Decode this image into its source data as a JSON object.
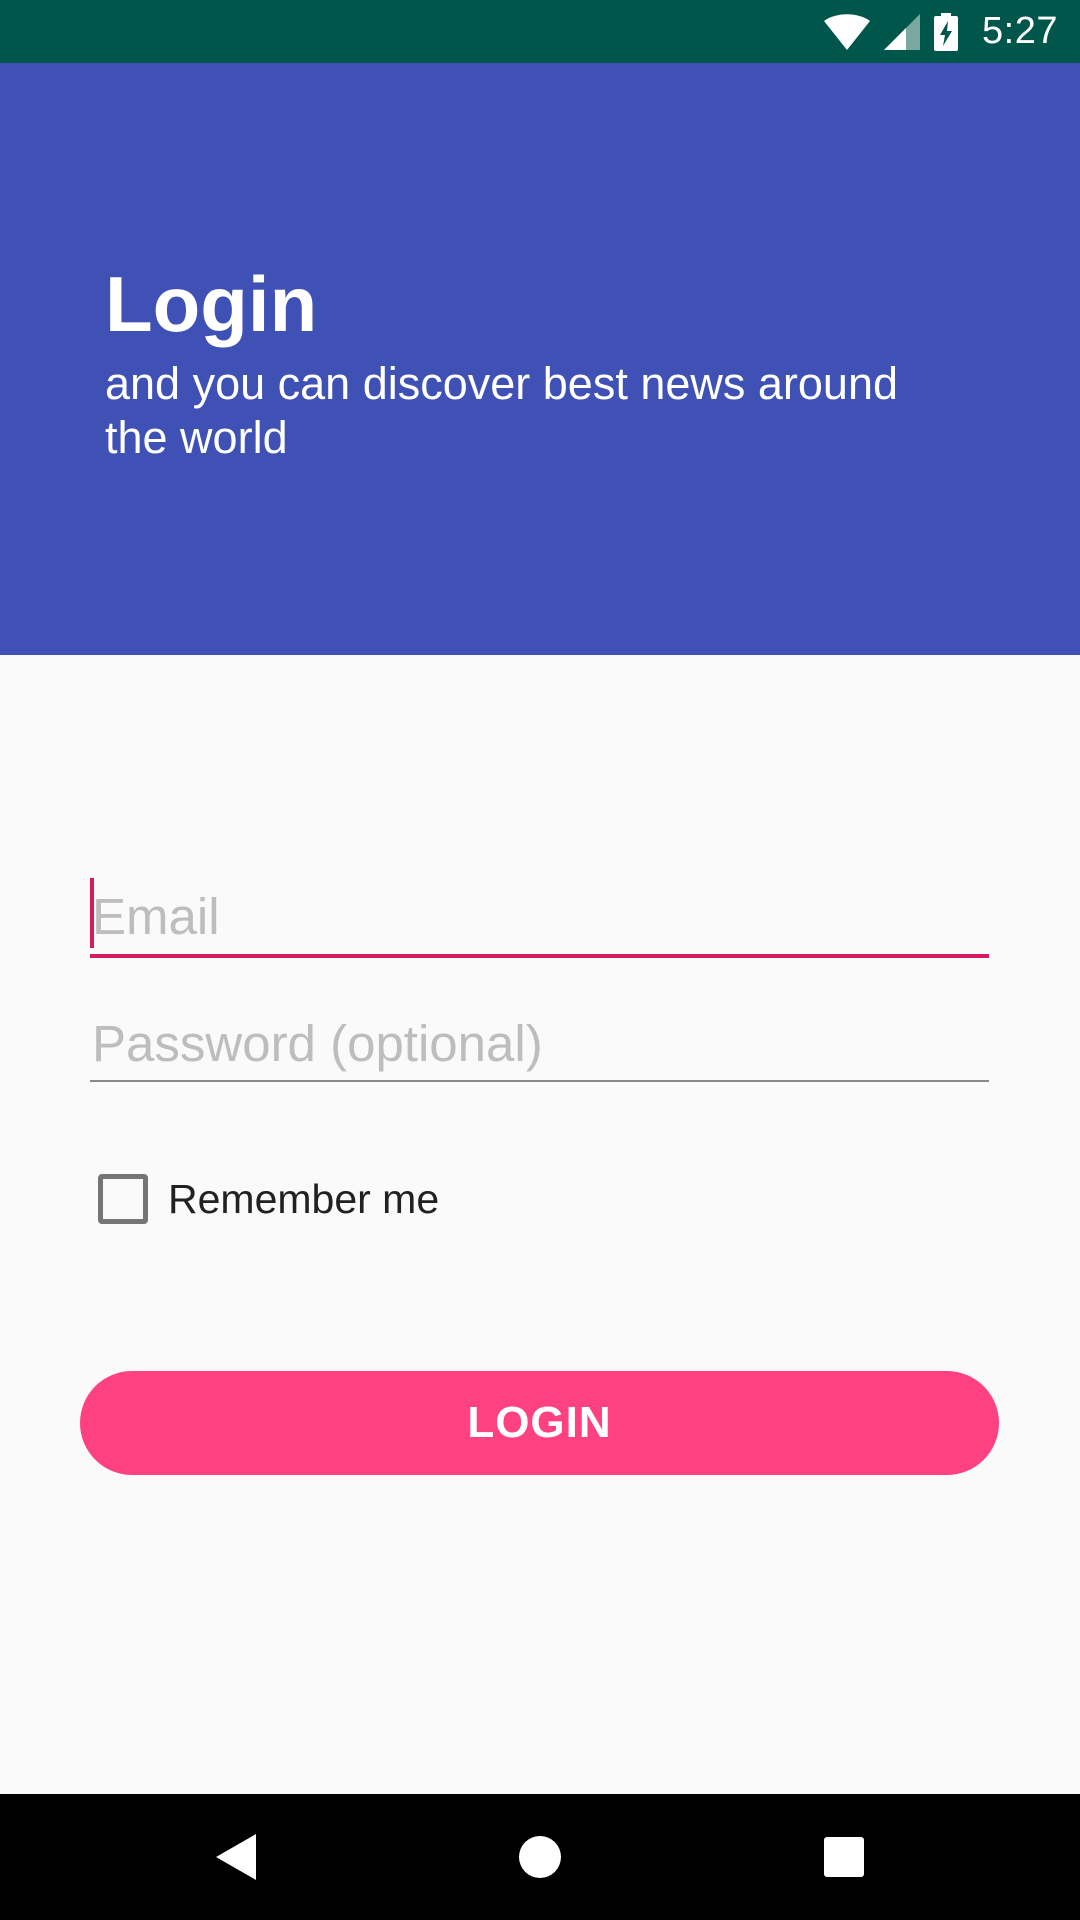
{
  "status_bar": {
    "time": "5:27",
    "icons": [
      "wifi-icon",
      "cell-signal-icon",
      "battery-charging-icon"
    ],
    "background": "#00564a"
  },
  "header": {
    "title": "Login",
    "subtitle": "and you can discover best news around the world",
    "background": "#3f51b5"
  },
  "form": {
    "email": {
      "placeholder": "Email",
      "value": ""
    },
    "password": {
      "placeholder": "Password (optional)",
      "value": ""
    },
    "remember_me": {
      "label": "Remember me",
      "checked": false
    },
    "login_button": {
      "label": "LOGIN",
      "color": "#ff4081"
    },
    "focus_color": "#d81b60"
  },
  "nav_bar": {
    "buttons": [
      "back-icon",
      "home-icon",
      "recents-icon"
    ]
  }
}
